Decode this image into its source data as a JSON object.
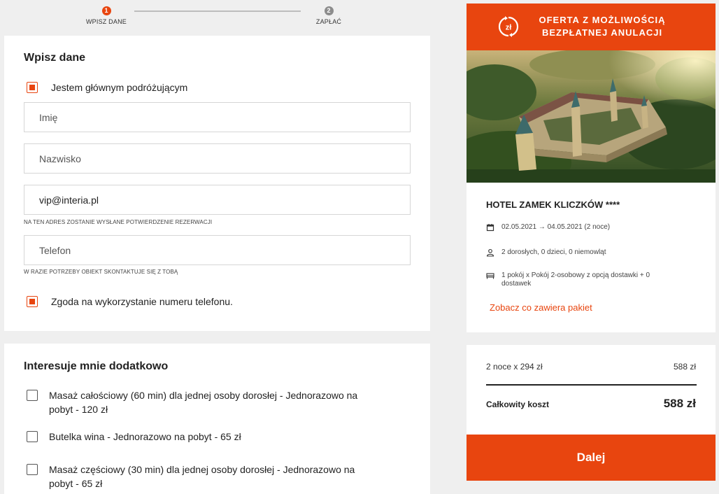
{
  "stepper": {
    "steps": [
      {
        "number": "1",
        "label": "WPISZ DANE",
        "active": true
      },
      {
        "number": "2",
        "label": "ZAPŁAĆ",
        "active": false
      }
    ]
  },
  "form": {
    "title": "Wpisz dane",
    "main_traveler_label": "Jestem głównym podróżującym",
    "main_traveler_checked": true,
    "first_name_placeholder": "Imię",
    "last_name_placeholder": "Nazwisko",
    "email_value": "vip@interia.pl",
    "email_hint": "NA TEN ADRES ZOSTANIE WYSŁANE POTWIERDZENIE REZERWACJI",
    "phone_placeholder": "Telefon",
    "phone_hint": "W RAZIE POTRZEBY OBIEKT SKONTAKTUJE SIĘ Z TOBĄ",
    "phone_consent_label": "Zgoda na wykorzystanie numeru telefonu.",
    "phone_consent_checked": true
  },
  "extras": {
    "title": "Interesuje mnie dodatkowo",
    "options": [
      {
        "label": "Masaż całościowy (60 min) dla jednej osoby dorosłej - Jednorazowo na pobyt - 120 zł",
        "checked": false
      },
      {
        "label": "Butelka wina - Jednorazowo na pobyt - 65 zł",
        "checked": false
      },
      {
        "label": "Masaż częściowy (30 min) dla jednej osoby dorosłej - Jednorazowo na pobyt - 65 zł",
        "checked": false
      }
    ]
  },
  "promo": {
    "icon_text": "zł",
    "line1": "OFERTA Z MOŻLIWOŚCIĄ",
    "line2": "BEZPŁATNEJ ANULACJI"
  },
  "hotel": {
    "name": "HOTEL ZAMEK KLICZKÓW ****",
    "dates": "02.05.2021 → 04.05.2021 (2 noce)",
    "guests": "2 dorosłych, 0 dzieci, 0 niemowląt",
    "room": "1 pokój x Pokój 2-osobowy z opcją dostawki + 0 dostawek",
    "package_link": "Zobacz co zawiera pakiet"
  },
  "pricing": {
    "nights_label": "2 noce x 294 zł",
    "nights_value": "588 zł",
    "total_label": "Całkowity koszt",
    "total_value": "588 zł"
  },
  "actions": {
    "next_label": "Dalej"
  },
  "colors": {
    "accent": "#e8450f",
    "background": "#efefef"
  }
}
